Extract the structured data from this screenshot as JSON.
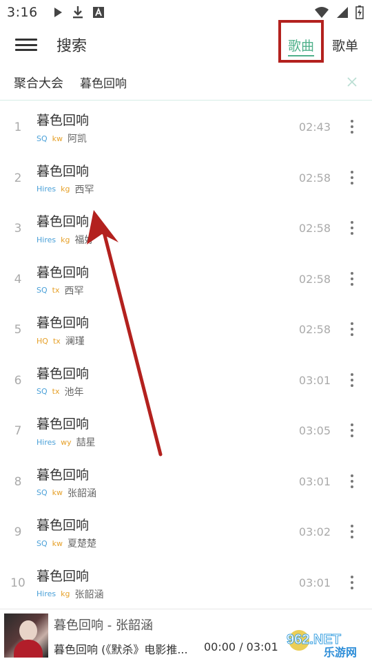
{
  "status_bar": {
    "time": "3:16",
    "left_icons": [
      "play-icon",
      "download-icon",
      "a-box-icon"
    ],
    "right_icons": [
      "wifi-icon",
      "signal-icon",
      "battery-charging-icon"
    ]
  },
  "header": {
    "title": "搜索",
    "tabs": [
      {
        "label": "歌曲",
        "active": true
      },
      {
        "label": "歌单",
        "active": false
      }
    ],
    "accent_color": "#4fb08a",
    "highlight_color": "#b3211e"
  },
  "search": {
    "source": "聚合大会",
    "query": "暮色回响"
  },
  "songs": [
    {
      "index": "1",
      "title": "暮色回响",
      "quality": "SQ",
      "source": "kw",
      "singer": "阿凯",
      "duration": "02:43"
    },
    {
      "index": "2",
      "title": "暮色回响",
      "quality": "Hires",
      "source": "kg",
      "singer": "西罕",
      "duration": "02:58"
    },
    {
      "index": "3",
      "title": "暮色回响",
      "quality": "Hires",
      "source": "kg",
      "singer": "福好",
      "duration": "02:58"
    },
    {
      "index": "4",
      "title": "暮色回响",
      "quality": "SQ",
      "source": "tx",
      "singer": "西罕",
      "duration": "02:58"
    },
    {
      "index": "5",
      "title": "暮色回响",
      "quality": "HQ",
      "source": "tx",
      "singer": "澜瑾",
      "duration": "02:58"
    },
    {
      "index": "6",
      "title": "暮色回响",
      "quality": "SQ",
      "source": "tx",
      "singer": "池年",
      "duration": "03:01"
    },
    {
      "index": "7",
      "title": "暮色回响",
      "quality": "Hires",
      "source": "wy",
      "singer": "喆星",
      "duration": "03:05"
    },
    {
      "index": "8",
      "title": "暮色回响",
      "quality": "SQ",
      "source": "kw",
      "singer": "张韶涵",
      "duration": "03:01"
    },
    {
      "index": "9",
      "title": "暮色回响",
      "quality": "SQ",
      "source": "kw",
      "singer": "夏楚楚",
      "duration": "03:02"
    },
    {
      "index": "10",
      "title": "暮色回响",
      "quality": "Hires",
      "source": "kg",
      "singer": "张韶涵",
      "duration": "03:01"
    }
  ],
  "player": {
    "title": "暮色回响 - 张韶涵",
    "subtitle": "暮色回响 (《默杀》电影推...",
    "time": "00:00 / 03:01",
    "cover_icon": "album-cover-image"
  },
  "watermark": {
    "brand": "962.NET",
    "caption": "乐游网"
  }
}
